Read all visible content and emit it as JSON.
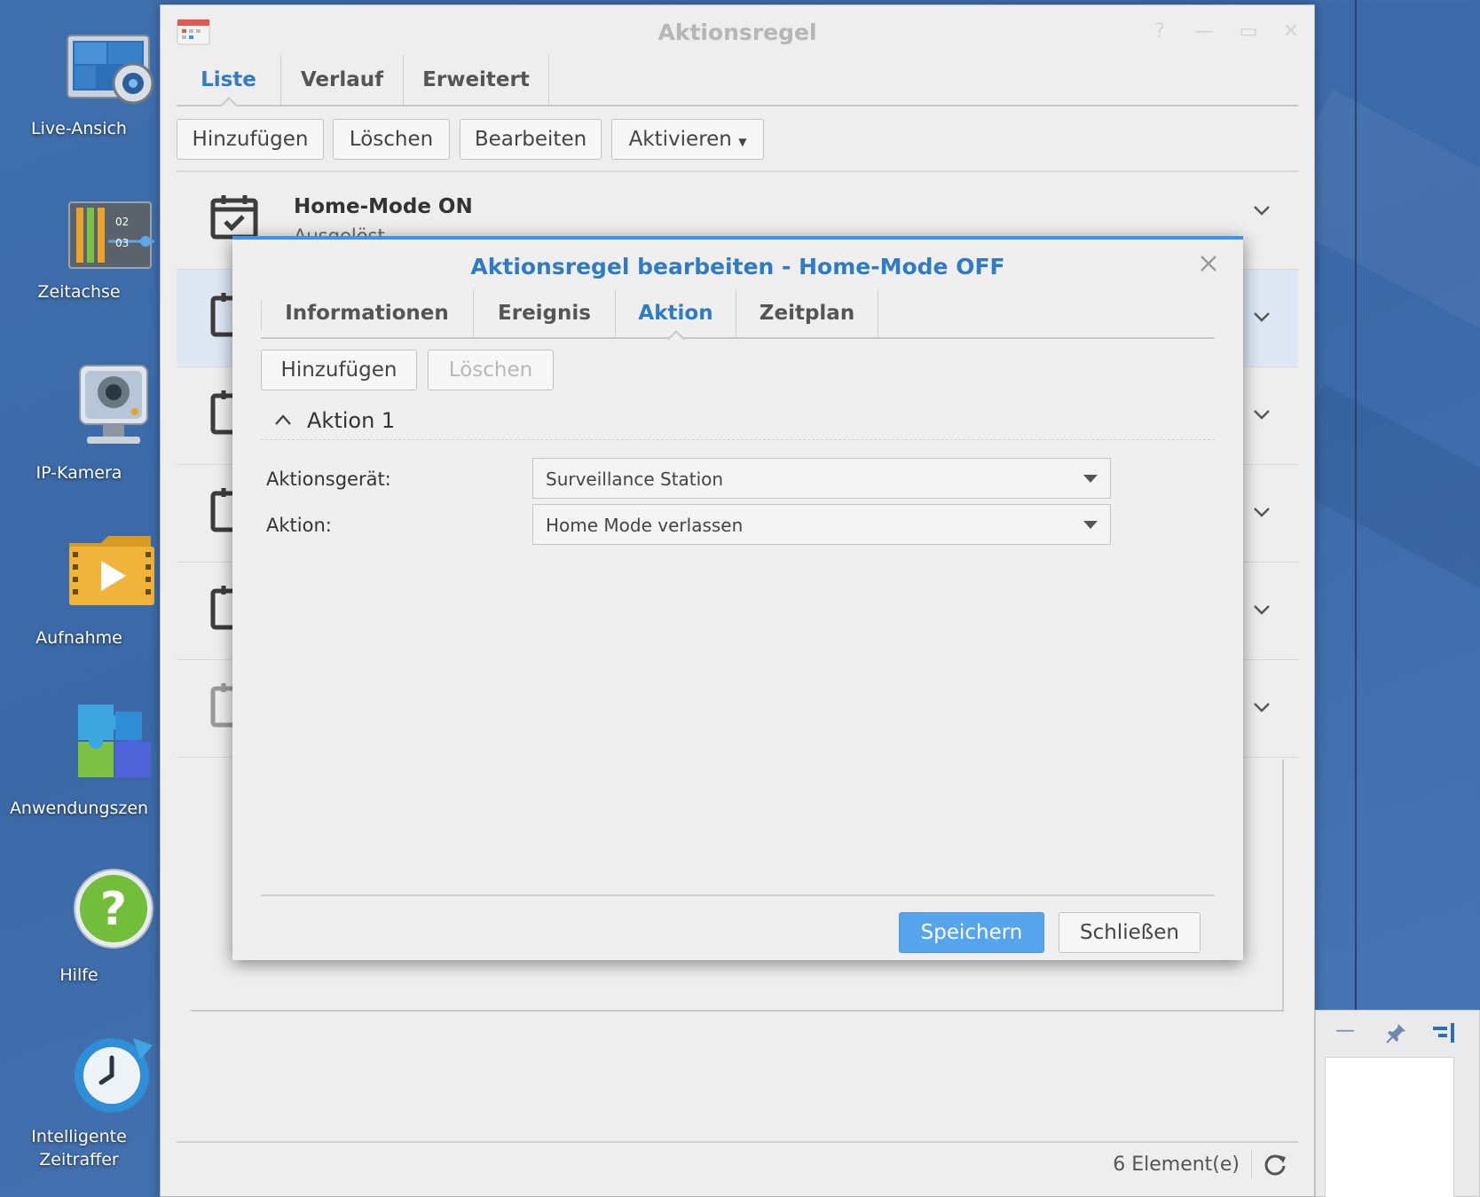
{
  "desktop": {
    "icons": [
      {
        "label": "Live-Ansich",
        "icon": "live-view-icon"
      },
      {
        "label": "Zeitachse",
        "icon": "timeline-icon"
      },
      {
        "label": "IP-Kamera",
        "icon": "ip-camera-icon"
      },
      {
        "label": "Aufnahme",
        "icon": "recording-icon"
      },
      {
        "label": "Anwendungszen",
        "icon": "app-center-icon"
      },
      {
        "label": "Hilfe",
        "icon": "help-icon"
      },
      {
        "label1": "Intelligente",
        "label2": "Zeitraffer",
        "icon": "time-lapse-icon"
      }
    ],
    "timeline_numbers": [
      "02",
      "03"
    ]
  },
  "window": {
    "title": "Aktionsregel",
    "tabs": [
      "Liste",
      "Verlauf",
      "Erweitert"
    ],
    "active_tab": "Liste",
    "toolbar": {
      "add": "Hinzufügen",
      "delete": "Löschen",
      "edit": "Bearbeiten",
      "activate": "Aktivieren"
    },
    "rules": [
      {
        "name": "Home-Mode ON",
        "status": "Ausgelöst"
      }
    ],
    "status": {
      "count": "6 Element(e)"
    }
  },
  "dialog": {
    "title": "Aktionsregel bearbeiten - Home-Mode OFF",
    "tabs": [
      "Informationen",
      "Ereignis",
      "Aktion",
      "Zeitplan"
    ],
    "active_tab": "Aktion",
    "toolbar": {
      "add": "Hinzufügen",
      "delete": "Löschen"
    },
    "section": "Aktion 1",
    "fields": {
      "device_label": "Aktionsgerät:",
      "device_value": "Surveillance Station",
      "action_label": "Aktion:",
      "action_value": "Home Mode verlassen"
    },
    "buttons": {
      "save": "Speichern",
      "close": "Schließen"
    }
  },
  "colors": {
    "accent": "#2f7cc4",
    "primary_button": "#56a4ec",
    "desktop": "#3f6fae"
  }
}
